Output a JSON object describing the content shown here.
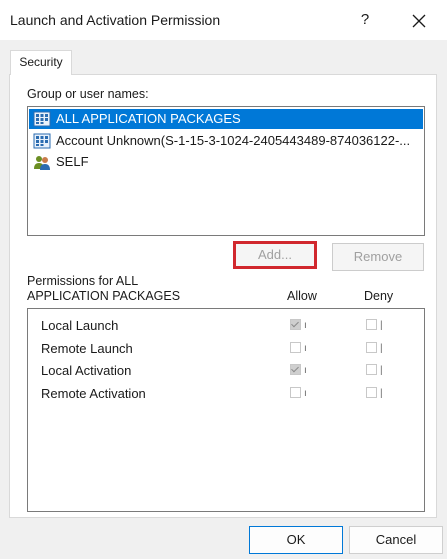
{
  "window": {
    "title": "Launch and Activation Permission",
    "help_glyph": "?",
    "close_icon": "close-icon"
  },
  "tabs": [
    {
      "label": "Security",
      "selected": true
    }
  ],
  "groups": {
    "label": "Group or user names:",
    "items": [
      {
        "name": "ALL APPLICATION PACKAGES",
        "icon": "app-packages-icon",
        "selected": true
      },
      {
        "name": "Account Unknown(S-1-15-3-1024-2405443489-874036122-...",
        "icon": "app-packages-icon",
        "selected": false
      },
      {
        "name": "SELF",
        "icon": "users-icon",
        "selected": false
      }
    ],
    "add_label": "Add...",
    "remove_label": "Remove"
  },
  "permissions": {
    "label_line1": "Permissions for ALL",
    "label_line2": "APPLICATION PACKAGES",
    "allow_header": "Allow",
    "deny_header": "Deny",
    "rows": [
      {
        "name": "Local Launch",
        "allow": true,
        "deny": false,
        "allow_mark": "ı",
        "deny_mark": "|"
      },
      {
        "name": "Remote Launch",
        "allow": false,
        "deny": false,
        "allow_mark": "ı",
        "deny_mark": "|"
      },
      {
        "name": "Local Activation",
        "allow": true,
        "deny": false,
        "allow_mark": "ı",
        "deny_mark": "|"
      },
      {
        "name": "Remote Activation",
        "allow": false,
        "deny": false,
        "allow_mark": "ı",
        "deny_mark": "|"
      }
    ]
  },
  "footer": {
    "ok_label": "OK",
    "cancel_label": "Cancel"
  },
  "colors": {
    "selection": "#0078d7",
    "highlight_box": "#d1282e"
  }
}
